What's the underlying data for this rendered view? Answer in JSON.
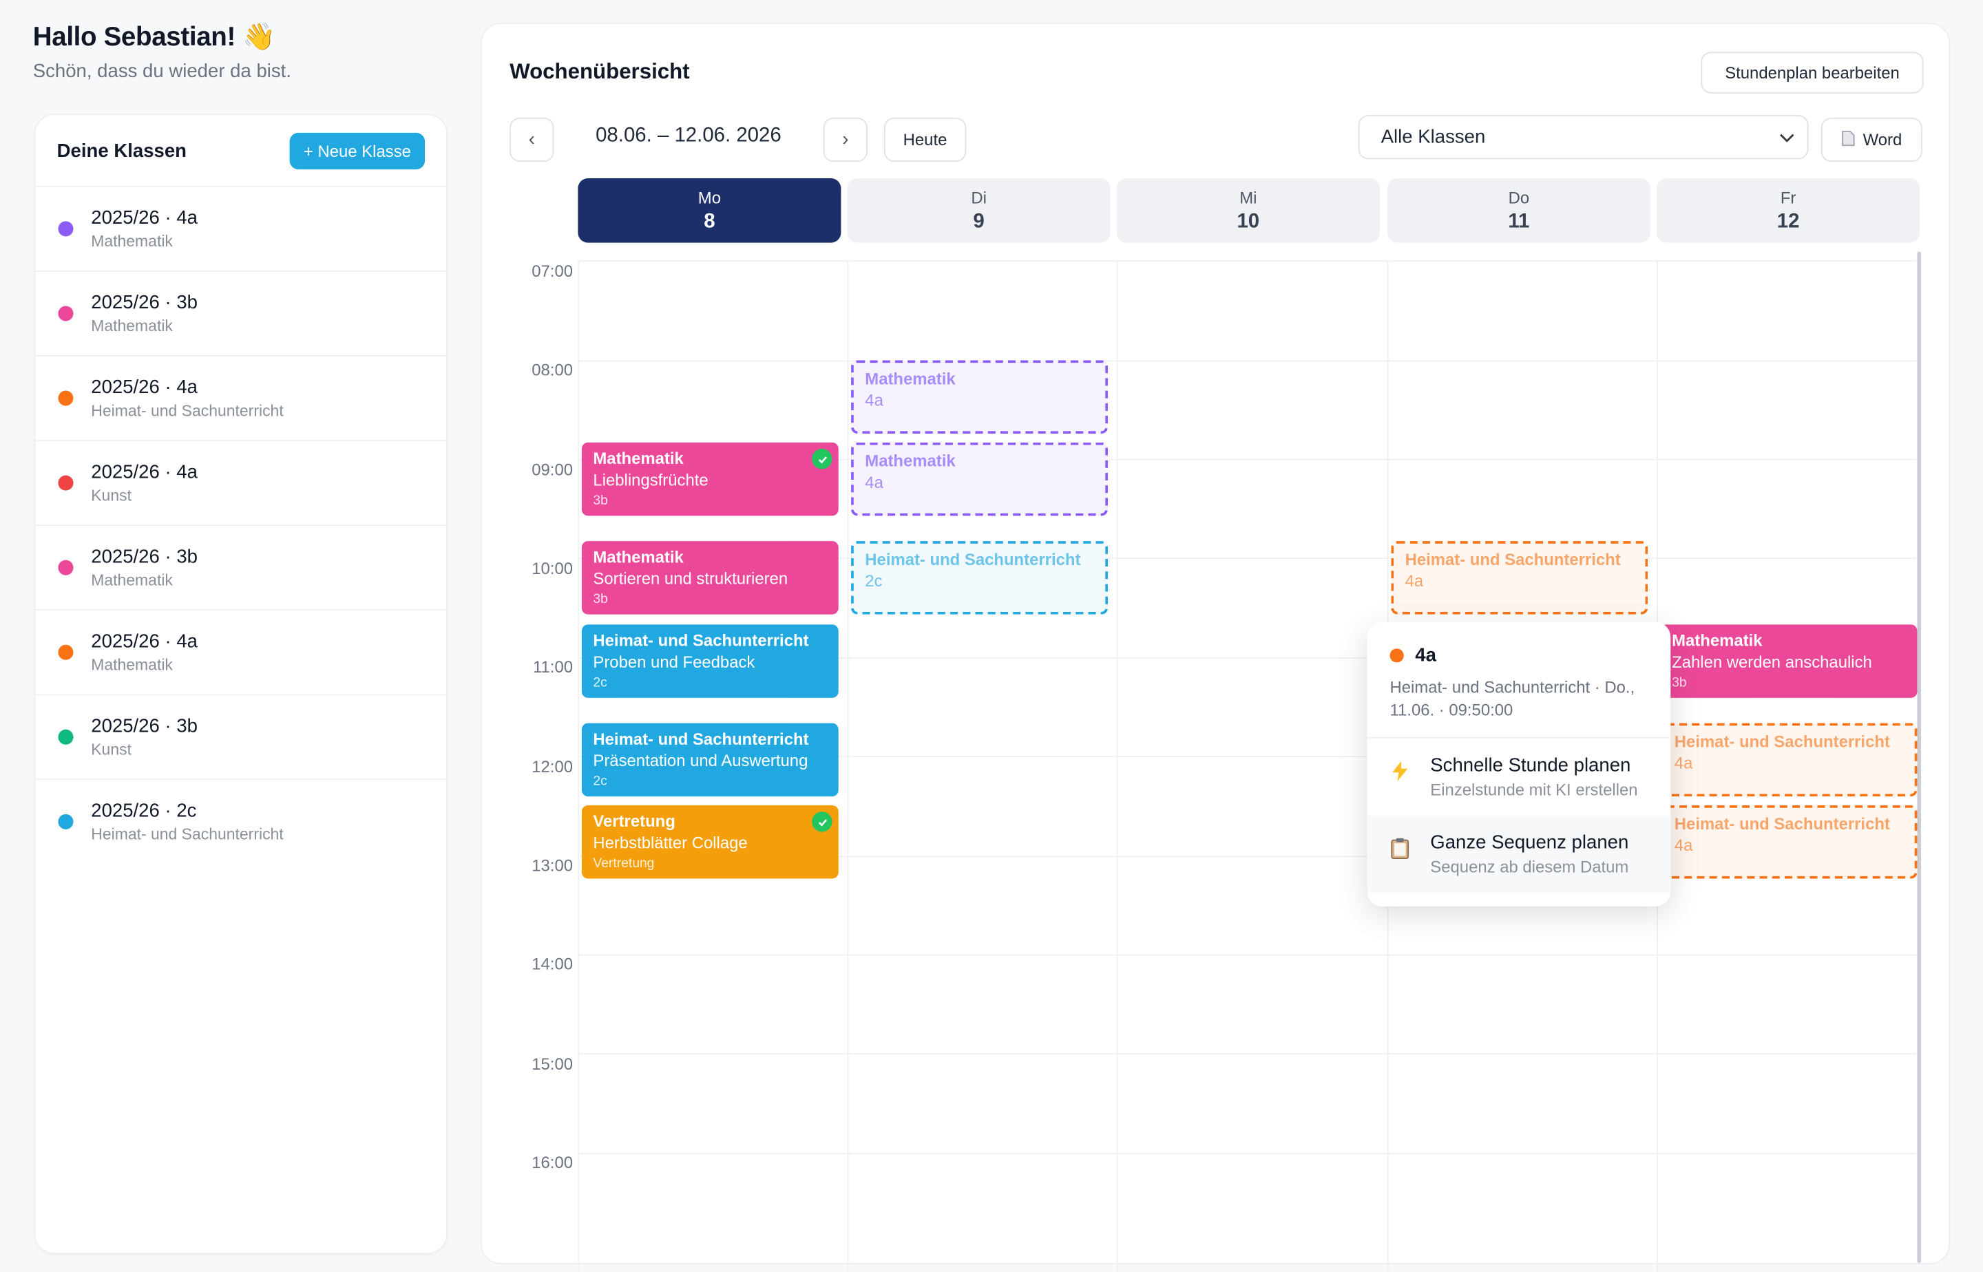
{
  "greeting": {
    "title": "Hallo Sebastian! 👋",
    "subtitle": "Schön, dass du wieder da bist."
  },
  "classes": {
    "title": "Deine Klassen",
    "new_button": "+ Neue Klasse",
    "items": [
      {
        "name": "2025/26 · 4a",
        "subject": "Mathematik",
        "color": "#8b5cf6"
      },
      {
        "name": "2025/26 · 3b",
        "subject": "Mathematik",
        "color": "#ec4899"
      },
      {
        "name": "2025/26 · 4a",
        "subject": "Heimat- und Sachunterricht",
        "color": "#f97316"
      },
      {
        "name": "2025/26 · 4a",
        "subject": "Kunst",
        "color": "#ef4444"
      },
      {
        "name": "2025/26 · 3b",
        "subject": "Mathematik",
        "color": "#ec4899"
      },
      {
        "name": "2025/26 · 4a",
        "subject": "Mathematik",
        "color": "#f97316"
      },
      {
        "name": "2025/26 · 3b",
        "subject": "Kunst",
        "color": "#10b981"
      },
      {
        "name": "2025/26 · 2c",
        "subject": "Heimat- und Sachunterricht",
        "color": "#22a8e0"
      }
    ]
  },
  "week": {
    "title": "Wochenübersicht",
    "edit_button": "Stundenplan bearbeiten",
    "prev": "‹",
    "next": "›",
    "range": "08.06. – 12.06. 2026",
    "today_button": "Heute",
    "filter_value": "Alle Klassen",
    "export_button": "Word",
    "days": [
      {
        "name": "Mo",
        "date": "8",
        "active": true
      },
      {
        "name": "Di",
        "date": "9",
        "active": false
      },
      {
        "name": "Mi",
        "date": "10",
        "active": false
      },
      {
        "name": "Do",
        "date": "11",
        "active": false
      },
      {
        "name": "Fr",
        "date": "12",
        "active": false
      }
    ],
    "times": [
      "07:00",
      "08:00",
      "09:00",
      "10:00",
      "11:00",
      "12:00",
      "13:00",
      "14:00",
      "15:00",
      "16:00"
    ]
  },
  "events": {
    "mo1": {
      "title": "Mathematik",
      "topic": "Lieblingsfrüchte",
      "cls": "3b"
    },
    "mo2": {
      "title": "Mathematik",
      "topic": "Sortieren und strukturieren",
      "cls": "3b"
    },
    "mo3": {
      "title": "Heimat- und Sachunterricht",
      "topic": "Proben und Feedback",
      "cls": "2c"
    },
    "mo4": {
      "title": "Heimat- und Sachunterricht",
      "topic": "Präsentation und Auswertung",
      "cls": "2c"
    },
    "mo5": {
      "title": "Vertretung",
      "topic": "Herbstblätter Collage",
      "cls": "Vertretung"
    },
    "di1": {
      "title": "Mathematik",
      "cls": "4a"
    },
    "di2": {
      "title": "Mathematik",
      "cls": "4a"
    },
    "di3": {
      "title": "Heimat- und Sachunterricht",
      "cls": "2c"
    },
    "do1": {
      "title": "Heimat- und Sachunterricht",
      "cls": "4a"
    },
    "fr1": {
      "title": "Mathematik",
      "topic": "Zahlen werden anschaulich",
      "cls": "3b"
    },
    "fr2": {
      "title": "Heimat- und Sachunterricht",
      "cls": "4a"
    },
    "fr3": {
      "title": "Heimat- und Sachunterricht",
      "cls": "4a"
    }
  },
  "popup": {
    "class_name": "4a",
    "meta": "Heimat- und Sachunterricht · Do., 11.06. · 09:50:00",
    "options": [
      {
        "title": "Schnelle Stunde planen",
        "subtitle": "Einzelstunde mit KI erstellen",
        "icon": "lightning-icon"
      },
      {
        "title": "Ganze Sequenz planen",
        "subtitle": "Sequenz ab diesem Datum",
        "icon": "clipboard-icon"
      }
    ]
  },
  "colors": {
    "navy": "#1c2f6b",
    "pink": "#ec4899",
    "blue": "#22a8e0",
    "amber": "#f59e0b",
    "purple": "#a78bfa",
    "orange": "#f97316",
    "green": "#22c55e"
  }
}
